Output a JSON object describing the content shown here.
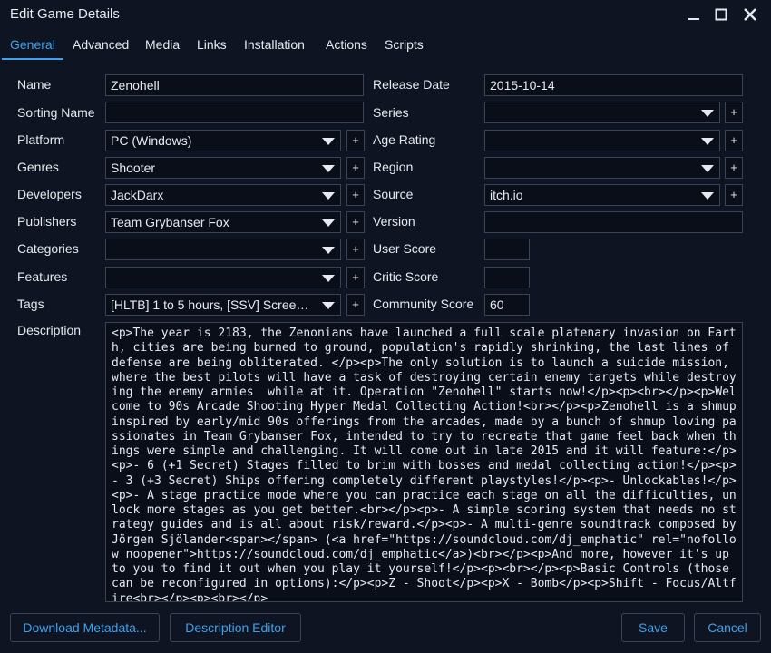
{
  "window": {
    "title": "Edit Game Details"
  },
  "tabs": [
    "General",
    "Advanced",
    "Media",
    "Links",
    "Installation",
    "Actions",
    "Scripts"
  ],
  "labels": {
    "name": "Name",
    "sorting_name": "Sorting Name",
    "platform": "Platform",
    "genres": "Genres",
    "developers": "Developers",
    "publishers": "Publishers",
    "categories": "Categories",
    "features": "Features",
    "tags": "Tags",
    "description": "Description",
    "release_date": "Release Date",
    "series": "Series",
    "age_rating": "Age Rating",
    "region": "Region",
    "source": "Source",
    "version": "Version",
    "user_score": "User Score",
    "critic_score": "Critic Score",
    "community_score": "Community Score"
  },
  "values": {
    "name": "Zenohell",
    "sorting_name": "",
    "platform": "PC (Windows)",
    "genres": "Shooter",
    "developers": "JackDarx",
    "publishers": "Team Grybanser Fox",
    "categories": "",
    "features": "",
    "tags": "[HLTB] 1 to 5 hours, [SSV] Screens...",
    "release_date": "2015-10-14",
    "series": "",
    "age_rating": "",
    "region": "",
    "source": "itch.io",
    "version": "",
    "user_score": "",
    "critic_score": "",
    "community_score": "60"
  },
  "plus_label": "+",
  "description_text": "<p>The year is 2183, the Zenonians have launched a full scale platenary invasion on Earth, cities are being burned to ground, population's rapidly shrinking, the last lines of defense are being obliterated. </p><p>The only solution is to launch a suicide mission, where the best pilots will have a task of destroying certain enemy targets while destroying the enemy armies  while at it. Operation \"Zenohell\" starts now!</p><p><br></p><p>Welcome to 90s Arcade Shooting Hyper Medal Collecting Action!<br></p><p>Zenohell is a shmup inspired by early/mid 90s offerings from the arcades, made by a bunch of shmup loving passionates in Team Grybanser Fox, intended to try to recreate that game feel back when things were simple and challenging. It will come out in late 2015 and it will feature:</p><p>- 6 (+1 Secret) Stages filled to brim with bosses and medal collecting action!</p><p>- 3 (+3 Secret) Ships offering completely different playstyles!</p><p>- Unlockables!</p><p>- A stage practice mode where you can practice each stage on all the difficulties, unlock more stages as you get better.<br></p><p>- A simple scoring system that needs no strategy guides and is all about risk/reward.</p><p>- A multi-genre soundtrack composed by Jörgen Sjölander<span></span> (<a href=\"https://soundcloud.com/dj_emphatic\" rel=\"nofollow noopener\">https://soundcloud.com/dj_emphatic</a>)<br></p><p>And more, however it's up to you to find it out when you play it yourself!</p><p><br></p><p>Basic Controls (those can be reconfigured in options):</p><p>Z - Shoot</p><p>X - Bomb</p><p>Shift - Focus/Altfire<br></p><p><br></p>",
  "buttons": {
    "download_metadata": "Download Metadata...",
    "description_editor": "Description Editor",
    "save": "Save",
    "cancel": "Cancel"
  },
  "colors": {
    "accent": "#3aa2ee",
    "background": "#0f1422",
    "field_bg": "#0a0e19",
    "border": "#3b4457",
    "text": "#e6e9ef"
  },
  "icons": {
    "minimize": "minimize-icon",
    "maximize": "maximize-icon",
    "close": "close-icon",
    "dropdown": "chevron-down-icon"
  }
}
